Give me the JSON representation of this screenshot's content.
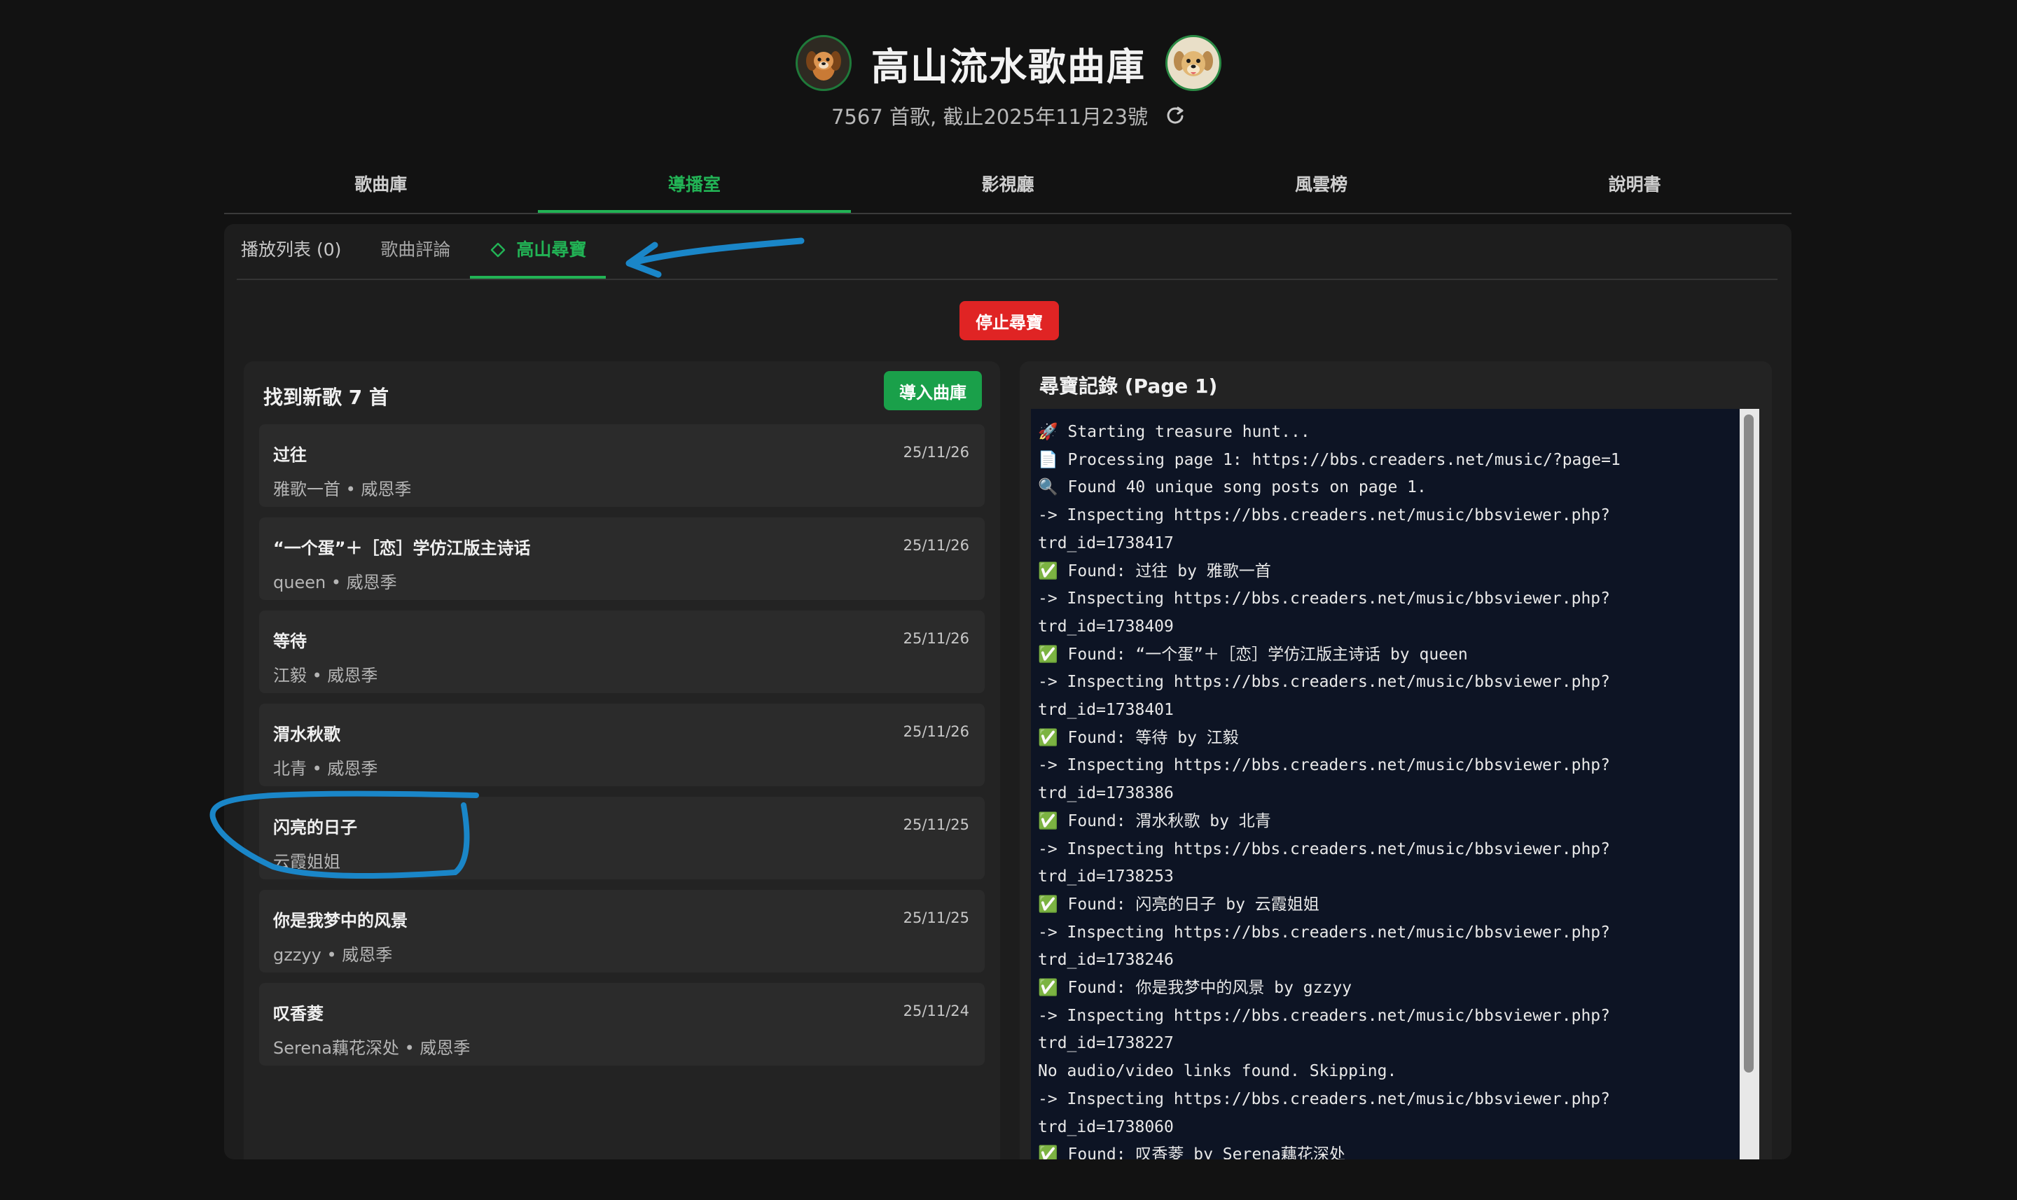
{
  "header": {
    "title": "高山流水歌曲庫",
    "subtitle": "7567 首歌, 截止2025年11月23號"
  },
  "main_nav": {
    "tabs": [
      {
        "label": "歌曲庫",
        "active": false
      },
      {
        "label": "導播室",
        "active": true
      },
      {
        "label": "影視廳",
        "active": false
      },
      {
        "label": "風雲榜",
        "active": false
      },
      {
        "label": "說明書",
        "active": false
      }
    ]
  },
  "sub_tabs": {
    "playlist": "播放列表 (0)",
    "reviews": "歌曲評論",
    "treasure": "高山尋寶"
  },
  "actions": {
    "stop": "停止尋寶",
    "import": "導入曲庫"
  },
  "results": {
    "title": "找到新歌 7 首",
    "songs": [
      {
        "title": "过往",
        "meta": "雅歌一首 • 威恩季",
        "date": "25/11/26"
      },
      {
        "title": "“一个蛋”＋［恋］学仿江版主诗话",
        "meta": "queen • 威恩季",
        "date": "25/11/26"
      },
      {
        "title": "等待",
        "meta": "江毅 • 威恩季",
        "date": "25/11/26"
      },
      {
        "title": "渭水秋歌",
        "meta": "北青 • 威恩季",
        "date": "25/11/26"
      },
      {
        "title": "闪亮的日子",
        "meta": "云霞姐姐",
        "date": "25/11/25"
      },
      {
        "title": "你是我梦中的风景",
        "meta": "gzzyy • 威恩季",
        "date": "25/11/25"
      },
      {
        "title": "叹香菱",
        "meta": "Serena藕花深处 • 威恩季",
        "date": "25/11/24"
      }
    ]
  },
  "log": {
    "title": "尋寶記錄 (Page 1)",
    "lines": [
      "🚀 Starting treasure hunt...",
      "📄 Processing page 1: https://bbs.creaders.net/music/?page=1",
      "🔍 Found 40 unique song posts on page 1.",
      "-> Inspecting https://bbs.creaders.net/music/bbsviewer.php?",
      "trd_id=1738417",
      "✅ Found: 过往 by 雅歌一首",
      "-> Inspecting https://bbs.creaders.net/music/bbsviewer.php?",
      "trd_id=1738409",
      "✅ Found: “一个蛋”＋［恋］学仿江版主诗话 by queen",
      "-> Inspecting https://bbs.creaders.net/music/bbsviewer.php?",
      "trd_id=1738401",
      "✅ Found: 等待 by 江毅",
      "-> Inspecting https://bbs.creaders.net/music/bbsviewer.php?",
      "trd_id=1738386",
      "✅ Found: 渭水秋歌 by 北青",
      "-> Inspecting https://bbs.creaders.net/music/bbsviewer.php?",
      "trd_id=1738253",
      "✅ Found: 闪亮的日子 by 云霞姐姐",
      "-> Inspecting https://bbs.creaders.net/music/bbsviewer.php?",
      "trd_id=1738246",
      "✅ Found: 你是我梦中的风景 by gzzyy",
      "-> Inspecting https://bbs.creaders.net/music/bbsviewer.php?",
      "trd_id=1738227",
      "No audio/video links found. Skipping.",
      "-> Inspecting https://bbs.creaders.net/music/bbsviewer.php?",
      "trd_id=1738060",
      "✅ Found: 叹香菱 by Serena藕花深处"
    ]
  },
  "colors": {
    "accent": "#22b355",
    "stop": "#e02424",
    "import": "#1aa04a",
    "annotation": "#1a86c8",
    "log_bg": "#0d1424"
  },
  "icons": {
    "refresh": "refresh-icon",
    "treasure_tab": "diamond-icon",
    "left_avatar": "puppy-avatar",
    "right_avatar": "dog-avatar"
  }
}
